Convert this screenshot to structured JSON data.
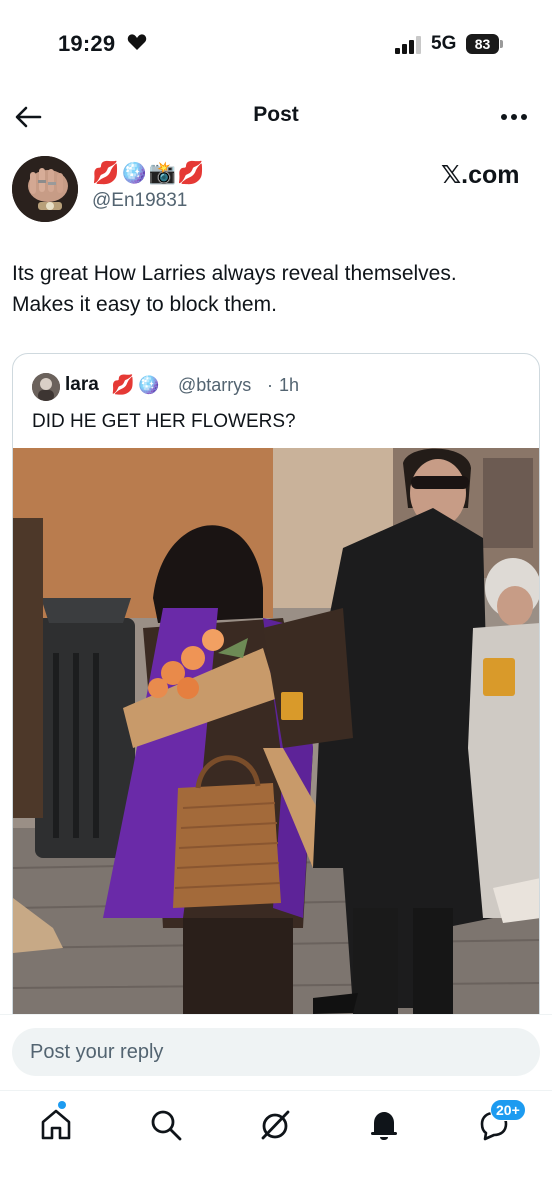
{
  "status_bar": {
    "time": "19:29",
    "network": "5G",
    "battery": "83"
  },
  "header": {
    "title": "Post"
  },
  "author": {
    "display_emojis": "💋🪩📸💋",
    "handle": "@En19831"
  },
  "source_label": "𝕏.com",
  "tweet": {
    "text_line1": "Its great How Larries always reveal themselves.",
    "text_line2": "Makes it easy to block them."
  },
  "quoted": {
    "name": "lara",
    "emojis": "💋🪩",
    "handle": "@btarrys",
    "separator": "·",
    "time": "1h",
    "text": "DID HE GET HER FLOWERS?"
  },
  "reply": {
    "placeholder": "Post your reply"
  },
  "nav": {
    "messages_badge": "20+"
  },
  "colors": {
    "accent": "#1d9bf0",
    "secondary_text": "#536471",
    "border": "#cfd9de"
  }
}
